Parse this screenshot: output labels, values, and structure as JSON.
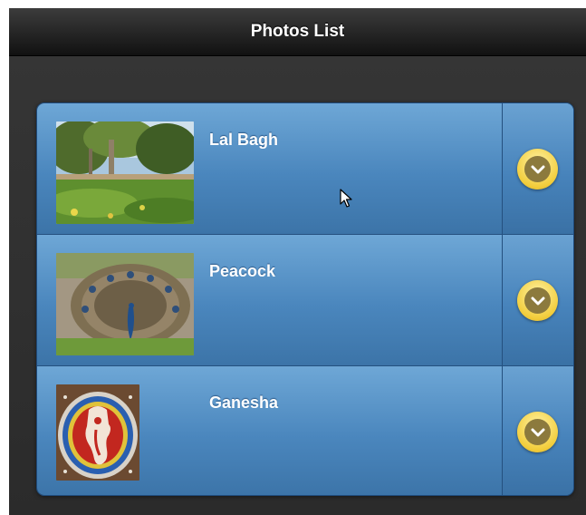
{
  "header": {
    "title": "Photos List"
  },
  "list": {
    "items": [
      {
        "title": "Lal Bagh",
        "image_icon": "park-photo"
      },
      {
        "title": "Peacock",
        "image_icon": "peacock-photo"
      },
      {
        "title": "Ganesha",
        "image_icon": "rangoli-ganesha-photo"
      }
    ],
    "split_icon": "chevron-down-circle-icon"
  },
  "colors": {
    "header": "#1a1a1a",
    "list_item": "#4a86bd",
    "split_button": "#f2cd3c"
  }
}
